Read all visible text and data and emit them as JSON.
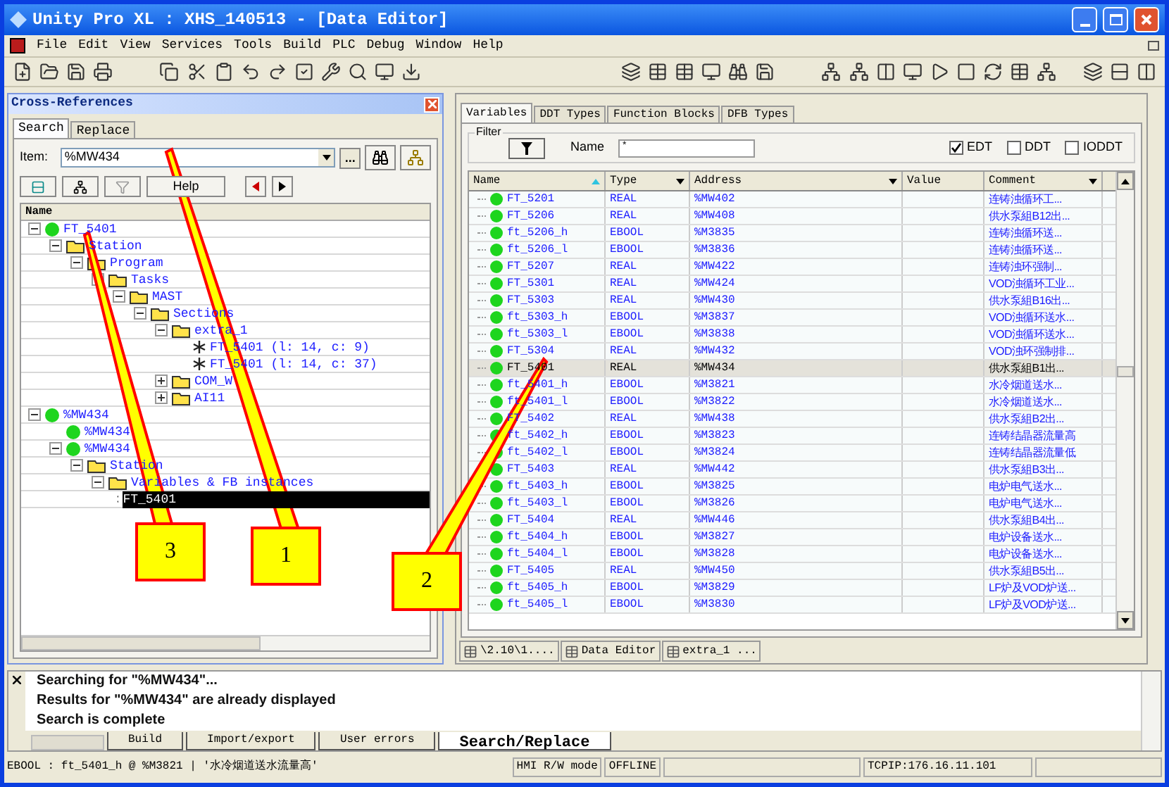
{
  "window": {
    "title": "Unity Pro XL : XHS_140513 - [Data Editor]"
  },
  "menu": [
    "File",
    "Edit",
    "View",
    "Services",
    "Tools",
    "Build",
    "PLC",
    "Debug",
    "Window",
    "Help"
  ],
  "cross_references": {
    "title": "Cross-References",
    "tabs": [
      {
        "label": "Search",
        "selected": true
      },
      {
        "label": "Replace",
        "selected": false
      }
    ],
    "item_label": "Item:",
    "item_value": "%MW434",
    "more_button": "...",
    "help_button": "Help",
    "tree_header": "Name",
    "tree": [
      {
        "label": "FT_5401",
        "kind": "var",
        "expanded": true,
        "selected": false,
        "children": [
          {
            "label": "Station",
            "kind": "folder",
            "expanded": true,
            "selected": false,
            "children": [
              {
                "label": "Program",
                "kind": "folder",
                "expanded": true,
                "selected": false,
                "children": [
                  {
                    "label": "Tasks",
                    "kind": "folder",
                    "expanded": true,
                    "selected": false,
                    "children": [
                      {
                        "label": "MAST",
                        "kind": "folder",
                        "expanded": true,
                        "selected": false,
                        "children": [
                          {
                            "label": "Sections",
                            "kind": "folder",
                            "expanded": true,
                            "selected": false,
                            "children": [
                              {
                                "label": "extra_1",
                                "kind": "folder",
                                "expanded": true,
                                "selected": false,
                                "children": [
                                  {
                                    "label": "FT_5401 (l: 14, c: 9)",
                                    "kind": "ref",
                                    "selected": false
                                  },
                                  {
                                    "label": "FT_5401 (l: 14, c: 37)",
                                    "kind": "ref",
                                    "selected": false
                                  }
                                ]
                              },
                              {
                                "label": "COM_W",
                                "kind": "folder",
                                "expanded": false,
                                "selected": false
                              },
                              {
                                "label": "AI11",
                                "kind": "folder",
                                "expanded": false,
                                "selected": false
                              }
                            ]
                          }
                        ]
                      }
                    ]
                  }
                ]
              }
            ]
          }
        ]
      },
      {
        "label": "%MW434",
        "kind": "var",
        "expanded": true,
        "selected": false,
        "children": [
          {
            "label": "%MW434",
            "kind": "var",
            "selected": false
          },
          {
            "label": "%MW434",
            "kind": "var",
            "expanded": true,
            "selected": false,
            "children": [
              {
                "label": "Station",
                "kind": "folder",
                "expanded": true,
                "selected": false,
                "children": [
                  {
                    "label": "Variables & FB instances",
                    "kind": "folder",
                    "expanded": true,
                    "selected": false,
                    "children": [
                      {
                        "label": "FT_5401",
                        "kind": "ref",
                        "selected": true
                      }
                    ]
                  }
                ]
              }
            ]
          }
        ]
      }
    ]
  },
  "data_editor": {
    "tabs": [
      {
        "label": "Variables",
        "selected": true
      },
      {
        "label": "DDT Types",
        "selected": false
      },
      {
        "label": "Function Blocks",
        "selected": false
      },
      {
        "label": "DFB Types",
        "selected": false
      }
    ],
    "filter": {
      "label": "Filter",
      "name_label": "Name",
      "name_value": "*",
      "checkboxes": [
        {
          "label": "EDT",
          "checked": true
        },
        {
          "label": "DDT",
          "checked": false
        },
        {
          "label": "IODDT",
          "checked": false
        }
      ]
    },
    "columns": [
      {
        "label": "Name",
        "sorted": true,
        "menu": false
      },
      {
        "label": "Type",
        "sorted": false,
        "menu": true
      },
      {
        "label": "Address",
        "sorted": false,
        "menu": true
      },
      {
        "label": "Value",
        "sorted": false,
        "menu": false
      },
      {
        "label": "Comment",
        "sorted": false,
        "menu": true
      }
    ],
    "rows": [
      {
        "name": "FT_5201",
        "type": "REAL",
        "address": "%MW402",
        "comment": "连铸浊循环工...",
        "selected": false
      },
      {
        "name": "FT_5206",
        "type": "REAL",
        "address": "%MW408",
        "comment": "供水泵組B12出...",
        "selected": false
      },
      {
        "name": "ft_5206_h",
        "type": "EBOOL",
        "address": "%M3835",
        "comment": "连铸浊循环送...",
        "selected": false
      },
      {
        "name": "ft_5206_l",
        "type": "EBOOL",
        "address": "%M3836",
        "comment": "连铸浊循环送...",
        "selected": false
      },
      {
        "name": "FT_5207",
        "type": "REAL",
        "address": "%MW422",
        "comment": "连铸浊环强制...",
        "selected": false
      },
      {
        "name": "FT_5301",
        "type": "REAL",
        "address": "%MW424",
        "comment": "VOD浊循环工业...",
        "selected": false
      },
      {
        "name": "FT_5303",
        "type": "REAL",
        "address": "%MW430",
        "comment": "供水泵組B16出...",
        "selected": false
      },
      {
        "name": "ft_5303_h",
        "type": "EBOOL",
        "address": "%M3837",
        "comment": "VOD浊循环送水...",
        "selected": false
      },
      {
        "name": "ft_5303_l",
        "type": "EBOOL",
        "address": "%M3838",
        "comment": "VOD浊循环送水...",
        "selected": false
      },
      {
        "name": "FT_5304",
        "type": "REAL",
        "address": "%MW432",
        "comment": "VOD浊环强制排...",
        "selected": false
      },
      {
        "name": "FT_5401",
        "type": "REAL",
        "address": "%MW434",
        "comment": "供水泵組B1出...",
        "selected": true
      },
      {
        "name": "ft_5401_h",
        "type": "EBOOL",
        "address": "%M3821",
        "comment": "水冷烟道送水...",
        "selected": false
      },
      {
        "name": "ft_5401_l",
        "type": "EBOOL",
        "address": "%M3822",
        "comment": "水冷烟道送水...",
        "selected": false
      },
      {
        "name": "FT_5402",
        "type": "REAL",
        "address": "%MW438",
        "comment": "供水泵組B2出...",
        "selected": false
      },
      {
        "name": "ft_5402_h",
        "type": "EBOOL",
        "address": "%M3823",
        "comment": "连铸结晶器流量高",
        "selected": false
      },
      {
        "name": "ft_5402_l",
        "type": "EBOOL",
        "address": "%M3824",
        "comment": "连铸结晶器流量低",
        "selected": false
      },
      {
        "name": "FT_5403",
        "type": "REAL",
        "address": "%MW442",
        "comment": "供水泵組B3出...",
        "selected": false
      },
      {
        "name": "ft_5403_h",
        "type": "EBOOL",
        "address": "%M3825",
        "comment": "电炉电气送水...",
        "selected": false
      },
      {
        "name": "ft_5403_l",
        "type": "EBOOL",
        "address": "%M3826",
        "comment": "电炉电气送水...",
        "selected": false
      },
      {
        "name": "FT_5404",
        "type": "REAL",
        "address": "%MW446",
        "comment": "供水泵組B4出...",
        "selected": false
      },
      {
        "name": "ft_5404_h",
        "type": "EBOOL",
        "address": "%M3827",
        "comment": "电炉设备送水...",
        "selected": false
      },
      {
        "name": "ft_5404_l",
        "type": "EBOOL",
        "address": "%M3828",
        "comment": "电炉设备送水...",
        "selected": false
      },
      {
        "name": "FT_5405",
        "type": "REAL",
        "address": "%MW450",
        "comment": "供水泵組B5出...",
        "selected": false
      },
      {
        "name": "ft_5405_h",
        "type": "EBOOL",
        "address": "%M3829",
        "comment": "LF炉及VOD炉送...",
        "selected": false
      },
      {
        "name": "ft_5405_l",
        "type": "EBOOL",
        "address": "%M3830",
        "comment": "LF炉及VOD炉送...",
        "selected": false
      }
    ]
  },
  "document_tabs": [
    {
      "label": "\\2.10\\1...."
    },
    {
      "label": "Data Editor"
    },
    {
      "label": "extra_1 ..."
    }
  ],
  "output": {
    "lines": [
      "Searching for \"%MW434\"...",
      "Results for \"%MW434\" are already displayed",
      "Search is complete"
    ],
    "tabs": [
      {
        "label": "Build",
        "selected": false
      },
      {
        "label": "Import/export",
        "selected": false
      },
      {
        "label": "User errors",
        "selected": false
      },
      {
        "label": "Search/Replace",
        "selected": true
      }
    ]
  },
  "status_bar": {
    "message": "EBOOL : ft_5401_h @ %M3821 | '水冷烟道送水流量高'",
    "mode": "HMI R/W mode",
    "connection": "OFFLINE",
    "address": "TCPIP:176.16.11.101"
  },
  "callouts": [
    {
      "label": "1"
    },
    {
      "label": "2"
    },
    {
      "label": "3"
    }
  ]
}
